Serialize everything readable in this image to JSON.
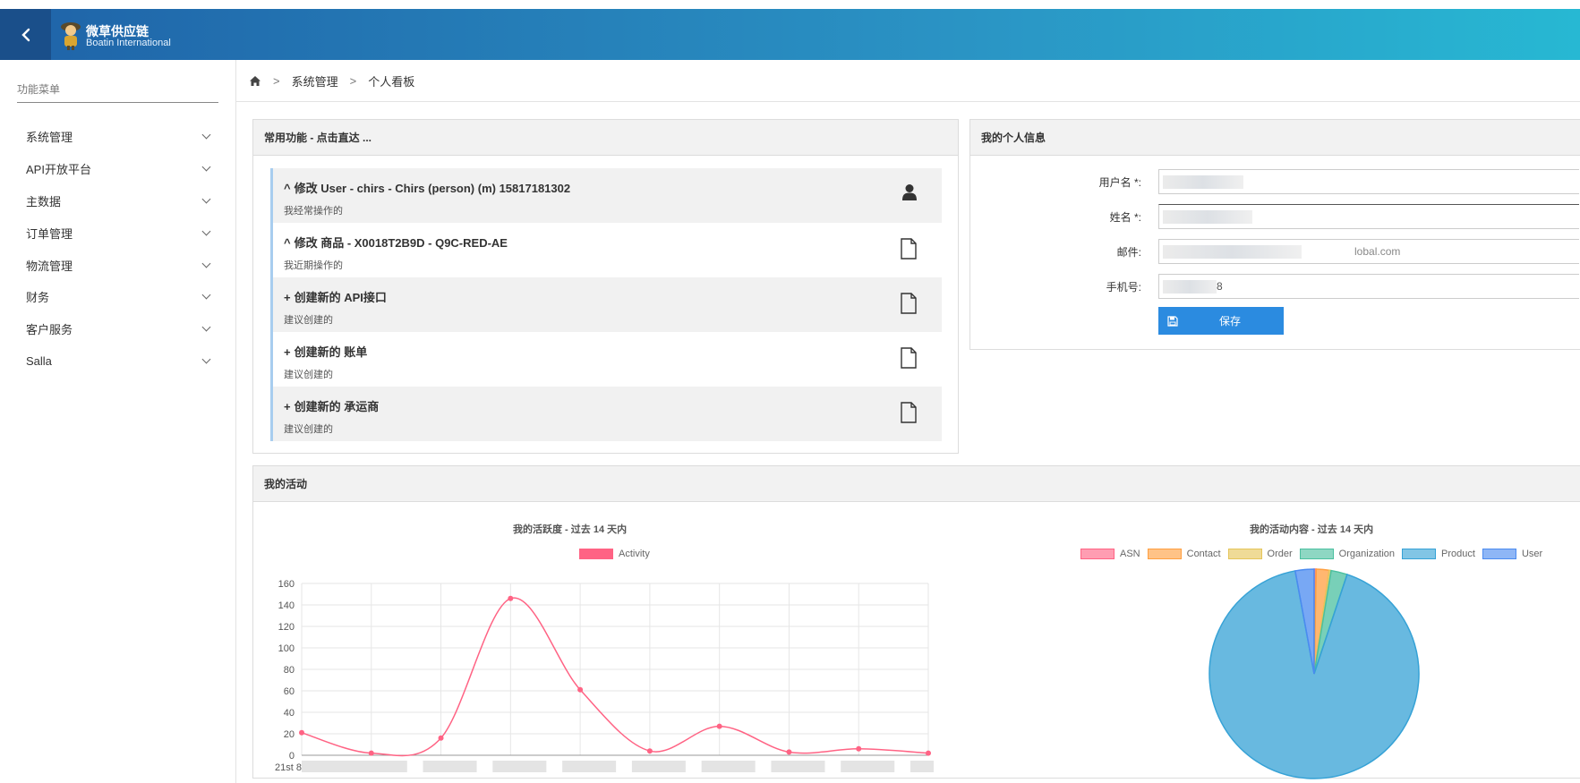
{
  "header": {
    "brand_name": "微草供应链",
    "brand_sub": "Boatin International",
    "back_icon": "chevron-left-icon"
  },
  "sidebar": {
    "title": "功能菜单",
    "items": [
      {
        "label": "系统管理"
      },
      {
        "label": "API开放平台"
      },
      {
        "label": "主数据"
      },
      {
        "label": "订单管理"
      },
      {
        "label": "物流管理"
      },
      {
        "label": "财务"
      },
      {
        "label": "客户服务"
      },
      {
        "label": "Salla"
      }
    ]
  },
  "breadcrumb": {
    "home_icon": "home-icon",
    "items": [
      "系统管理",
      "个人看板"
    ],
    "separator": ">"
  },
  "shortcuts": {
    "title": "常用功能 - 点击直达 ...",
    "items": [
      {
        "prefix": "^",
        "title": "修改 User - chirs - Chirs (person) (m) 15817181302",
        "sub": "我经常操作的",
        "icon": "user-icon"
      },
      {
        "prefix": "^",
        "title": "修改 商品 - X0018T2B9D - Q9C-RED-AE",
        "sub": "我近期操作的",
        "icon": "document-icon"
      },
      {
        "prefix": "+",
        "title": "创建新的 API接口",
        "sub": "建议创建的",
        "icon": "document-icon"
      },
      {
        "prefix": "+",
        "title": "创建新的 账单",
        "sub": "建议创建的",
        "icon": "document-icon"
      },
      {
        "prefix": "+",
        "title": "创建新的 承运商",
        "sub": "建议创建的",
        "icon": "document-icon"
      }
    ]
  },
  "profile": {
    "title": "我的个人信息",
    "fields": [
      {
        "label": "用户名 *:",
        "value": ""
      },
      {
        "label": "姓名 *:",
        "value": ""
      },
      {
        "label": "邮件:",
        "value": "lobal.com"
      },
      {
        "label": "手机号:",
        "value": "8"
      }
    ],
    "save_label": "保存",
    "save_icon": "floppy-disk-icon"
  },
  "activity": {
    "title": "我的活动",
    "line_title": "我的活跃度 - 过去 14 天内",
    "pie_title": "我的活动内容 - 过去 14 天内",
    "first_x_label": "21st 8月"
  },
  "colors": {
    "accent": "#2b8be0",
    "line": "#ff6384",
    "pie_asn": "#ff6384",
    "pie_contact": "#ff9f40",
    "pie_order": "#e5c55a",
    "pie_org": "#4bc0a0",
    "pie_product": "#36a2d6",
    "pie_user": "#4b8bf0"
  },
  "chart_data": [
    {
      "type": "line",
      "title": "我的活跃度 - 过去 14 天内",
      "series": [
        {
          "name": "Activity",
          "values": [
            21,
            2,
            16,
            146,
            61,
            4,
            27,
            3,
            6,
            2
          ]
        }
      ],
      "x": [
        "21st 8月",
        "",
        "",
        "",
        "",
        "",
        "",
        "",
        "",
        ""
      ],
      "ylim": [
        0,
        160
      ],
      "yticks": [
        0,
        20,
        40,
        60,
        80,
        100,
        120,
        140,
        160
      ],
      "grid": true,
      "legend": "top"
    },
    {
      "type": "pie",
      "title": "我的活动内容 - 过去 14 天内",
      "categories": [
        "ASN",
        "Contact",
        "Order",
        "Organization",
        "Product",
        "User"
      ],
      "values": [
        0.3,
        2,
        0.3,
        2.5,
        92,
        2.9
      ],
      "legend": "top"
    }
  ]
}
